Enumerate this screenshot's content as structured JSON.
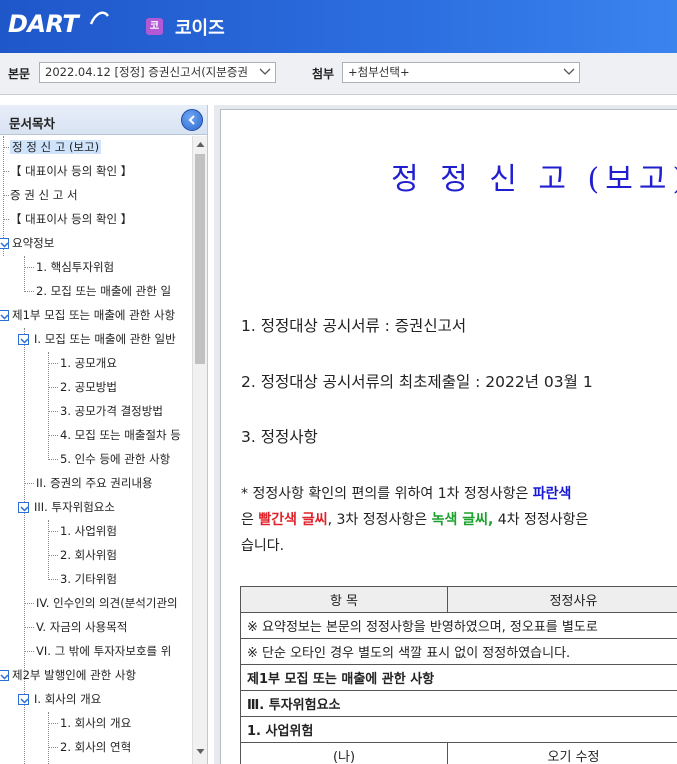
{
  "header": {
    "logo": "DART",
    "app_badge": "코",
    "app_name": "코이즈"
  },
  "toolbar": {
    "main_label": "본문",
    "main_select": "2022.04.12 [정정] 증권신고서(지분증권",
    "attach_label": "첨부",
    "attach_select": "+첨부선택+"
  },
  "sidebar": {
    "title": "문서목차",
    "items": [
      {
        "label": "정 정 신 고 (보고)"
      },
      {
        "label": "【 대표이사 등의 확인 】"
      },
      {
        "label": "증 권 신 고 서"
      },
      {
        "label": "【 대표이사 등의 확인 】"
      },
      {
        "label": "요약정보"
      },
      {
        "label": "1. 핵심투자위험"
      },
      {
        "label": "2. 모집 또는 매출에 관한 일"
      },
      {
        "label": "제1부 모집 또는 매출에 관한 사항"
      },
      {
        "label": "I. 모집 또는 매출에 관한 일반"
      },
      {
        "label": "1. 공모개요"
      },
      {
        "label": "2. 공모방법"
      },
      {
        "label": "3. 공모가격 결정방법"
      },
      {
        "label": "4. 모집 또는 매출절차 등"
      },
      {
        "label": "5. 인수 등에 관한 사항"
      },
      {
        "label": "II. 증권의 주요 권리내용"
      },
      {
        "label": "III. 투자위험요소"
      },
      {
        "label": "1. 사업위험"
      },
      {
        "label": "2. 회사위험"
      },
      {
        "label": "3. 기타위험"
      },
      {
        "label": "IV. 인수인의 의견(분석기관의"
      },
      {
        "label": "V. 자금의 사용목적"
      },
      {
        "label": "VI. 그 밖에 투자자보호를 위"
      },
      {
        "label": "제2부 발행인에 관한 사항"
      },
      {
        "label": "I. 회사의 개요"
      },
      {
        "label": "1. 회사의 개요"
      },
      {
        "label": "2. 회사의 연혁"
      }
    ]
  },
  "document": {
    "title": "정 정 신 고 (보고)",
    "line1": "1. 정정대상 공시서류 : 증권신고서",
    "line2": "2. 정정대상 공시서류의 최초제출일 : 2022년 03월 1",
    "line3": "3. 정정사항",
    "note": {
      "l1_a": " * 정정사항 확인의 편의를 위하여 1차 정정사항은 ",
      "l1_blue": "파란색",
      "l2_a": "은 ",
      "l2_red": "빨간색 글씨",
      "l2_b": ", 3차 정정사항은 ",
      "l2_green": "녹색 글씨,",
      "l2_c": " 4차 정정사항은",
      "l3": "습니다."
    },
    "table": {
      "header_item": "항  목",
      "header_reason": "정정사유",
      "note1": "※ 요약정보는 본문의 정정사항을 반영하였으며, 정오표를 별도로",
      "note2": "※ 단순 오타인 경우 별도의 색깔 표시 없이 정정하였습니다.",
      "section1": "제1부 모집 또는 매출에 관한 사항",
      "section2": "Ⅲ. 투자위험요소",
      "section3": "1. 사업위험",
      "row_item": "(나)",
      "row_reason": "오기 수정"
    }
  },
  "colors": {
    "header_blue": "#2c6ee0",
    "title_blue": "#1f1fd0",
    "red": "#e0232b",
    "green": "#1aa12c"
  }
}
